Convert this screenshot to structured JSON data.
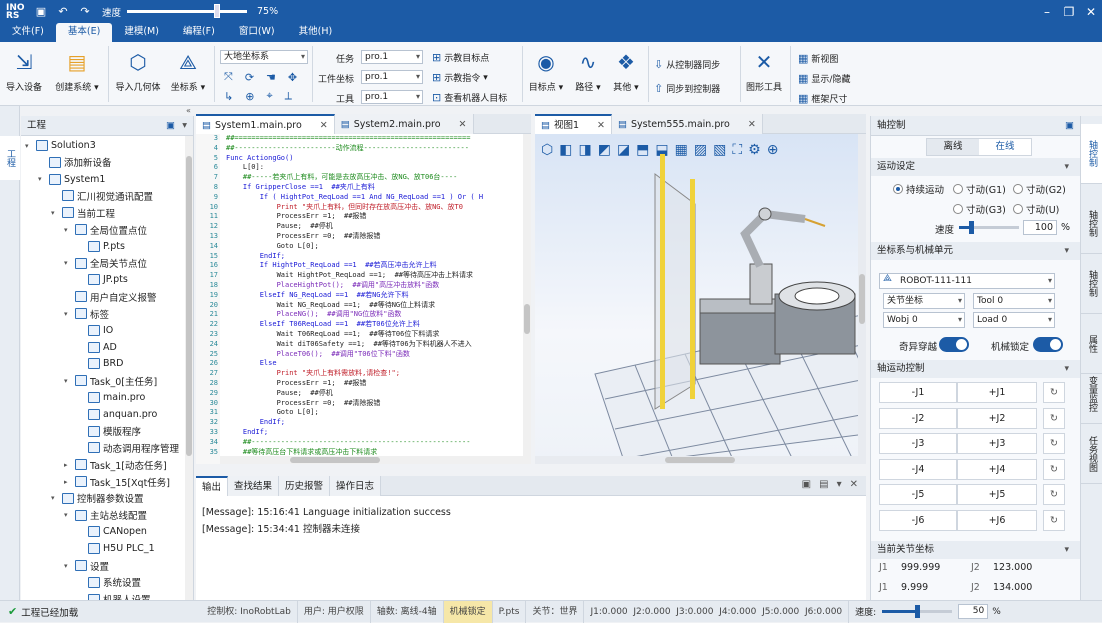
{
  "title_bar": {
    "logo": "INO RS",
    "speed_label": "速度",
    "speed_value": "75%",
    "speed_fraction": 0.75
  },
  "menu": {
    "items": [
      {
        "label": "文件(F)"
      },
      {
        "label": "基本(E)"
      },
      {
        "label": "建模(M)"
      },
      {
        "label": "编程(F)"
      },
      {
        "label": "窗口(W)"
      },
      {
        "label": "其他(H)"
      }
    ]
  },
  "ribbon": {
    "import_device": "导入设备",
    "create_system": "创建系统",
    "import_geometry": "导入几何体",
    "coord_system": "坐标系",
    "coord_select": "大地坐标系",
    "task_label": "任务",
    "task_value": "pro.1",
    "workobj_label": "工件坐标",
    "workobj_value": "pro.1",
    "tool_label": "工具",
    "tool_value": "pro.1",
    "teach_target": "示教目标点",
    "teach_cmd": "示教指令",
    "view_robot_target": "查看机器人目标",
    "target_point": "目标点",
    "path": "路径",
    "other": "其他",
    "sync_from_ctrl": "从控制器同步",
    "sync_to_ctrl": "同步到控制器",
    "graphic_tools": "图形工具",
    "new_view": "新视图",
    "show_hide": "显示/隐藏",
    "frame_size": "框架尺寸"
  },
  "project_panel": {
    "title": "工程",
    "side_tab": "工程",
    "tree": [
      {
        "label": "Solution3",
        "level": 0,
        "exp": "▾"
      },
      {
        "label": "添加新设备",
        "level": 1,
        "exp": ""
      },
      {
        "label": "System1",
        "level": 1,
        "exp": "▾"
      },
      {
        "label": "汇川视觉通讯配置",
        "level": 2,
        "exp": ""
      },
      {
        "label": "当前工程",
        "level": 2,
        "exp": "▾"
      },
      {
        "label": "全局位置点位",
        "level": 3,
        "exp": "▾"
      },
      {
        "label": "P.pts",
        "level": 4,
        "exp": ""
      },
      {
        "label": "全局关节点位",
        "level": 3,
        "exp": "▾"
      },
      {
        "label": "JP.pts",
        "level": 4,
        "exp": ""
      },
      {
        "label": "用户自定义报警",
        "level": 3,
        "exp": ""
      },
      {
        "label": "标签",
        "level": 3,
        "exp": "▾"
      },
      {
        "label": "IO",
        "level": 4,
        "exp": ""
      },
      {
        "label": "AD",
        "level": 4,
        "exp": ""
      },
      {
        "label": "BRD",
        "level": 4,
        "exp": ""
      },
      {
        "label": "Task_0[主任务]",
        "level": 3,
        "exp": "▾"
      },
      {
        "label": "main.pro",
        "level": 4,
        "exp": ""
      },
      {
        "label": "anquan.pro",
        "level": 4,
        "exp": ""
      },
      {
        "label": "模版程序",
        "level": 4,
        "exp": ""
      },
      {
        "label": "动态调用程序管理",
        "level": 4,
        "exp": ""
      },
      {
        "label": "Task_1[动态任务]",
        "level": 3,
        "exp": "▸"
      },
      {
        "label": "Task_15[Xqt任务]",
        "level": 3,
        "exp": "▸"
      },
      {
        "label": "控制器参数设置",
        "level": 2,
        "exp": "▾"
      },
      {
        "label": "主站总线配置",
        "level": 3,
        "exp": "▾"
      },
      {
        "label": "CANopen",
        "level": 4,
        "exp": ""
      },
      {
        "label": "H5U PLC_1",
        "level": 4,
        "exp": ""
      },
      {
        "label": "设置",
        "level": 3,
        "exp": "▾"
      },
      {
        "label": "系统设置",
        "level": 4,
        "exp": ""
      },
      {
        "label": "机器人设置",
        "level": 4,
        "exp": ""
      }
    ]
  },
  "editor_tabs": [
    {
      "label": "System1.main.pro"
    },
    {
      "label": "System2.main.pro"
    }
  ],
  "code_lines": [
    {
      "n": "3",
      "t": "##========================================================",
      "c": "cm"
    },
    {
      "n": "4",
      "t": "##------------------------动作流程-------------------------",
      "c": "cm"
    },
    {
      "n": "5",
      "t": "Func ActiongGo()",
      "c": "kw"
    },
    {
      "n": "6",
      "t": "    L[0]:",
      "c": ""
    },
    {
      "n": "7",
      "t": "    ##-----若夹爪上有料，可能是去放高压冲击、放NG、放T06台----",
      "c": "cm"
    },
    {
      "n": "8",
      "t": "    If GripperClose ==1  ##夹爪上有料",
      "c": "kw"
    },
    {
      "n": "9",
      "t": "        If ( HightPot_ReqLoad ==1 And NG_ReqLoad ==1 ) Or ( H",
      "c": "kw"
    },
    {
      "n": "10",
      "t": "            Print \"夹爪上有料，但同时存在放高压冲击、放NG、放T0",
      "c": "st"
    },
    {
      "n": "11",
      "t": "            ProcessErr =1;  ##报错",
      "c": ""
    },
    {
      "n": "12",
      "t": "            Pause;  ##停机",
      "c": ""
    },
    {
      "n": "13",
      "t": "            ProcessErr =0;  ##清除报错",
      "c": ""
    },
    {
      "n": "14",
      "t": "            Goto L[0];",
      "c": ""
    },
    {
      "n": "15",
      "t": "        EndIf;",
      "c": "kw"
    },
    {
      "n": "16",
      "t": "        If HightPot_ReqLoad ==1  ##若高压冲击允许上料",
      "c": "kw"
    },
    {
      "n": "17",
      "t": "            Wait HightPot_ReqLoad ==1;  ##等待高压冲击上料请求",
      "c": ""
    },
    {
      "n": "18",
      "t": "            PlaceHightPot();  ##调用\"高压冲击放料\"函数",
      "c": "fn"
    },
    {
      "n": "19",
      "t": "        ElseIf NG_ReqLoad ==1  ##若NG允许下料",
      "c": "kw"
    },
    {
      "n": "20",
      "t": "            Wait NG_ReqLoad ==1;  ##等待NG位上料请求",
      "c": ""
    },
    {
      "n": "21",
      "t": "            PlaceNG();  ##调用\"NG位放料\"函数",
      "c": "fn"
    },
    {
      "n": "22",
      "t": "        ElseIf T06ReqLoad ==1  ##若T06位允许上料",
      "c": "kw"
    },
    {
      "n": "23",
      "t": "            Wait T06ReqLoad ==1;  ##等待T06位下料请求",
      "c": ""
    },
    {
      "n": "24",
      "t": "            Wait diT06Safety ==1;  ##等待T06为下料机器人不进入",
      "c": ""
    },
    {
      "n": "25",
      "t": "            PlaceT06();  ##调用\"T06位下料\"函数",
      "c": "fn"
    },
    {
      "n": "26",
      "t": "        Else",
      "c": "kw"
    },
    {
      "n": "27",
      "t": "            Print \"夹爪上有料需放料,请检查!\";",
      "c": "st"
    },
    {
      "n": "28",
      "t": "            ProcessErr =1;  ##报错",
      "c": ""
    },
    {
      "n": "29",
      "t": "            Pause;  ##停机",
      "c": ""
    },
    {
      "n": "30",
      "t": "            ProcessErr =0;  ##清除报错",
      "c": ""
    },
    {
      "n": "31",
      "t": "            Goto L[0];",
      "c": ""
    },
    {
      "n": "32",
      "t": "        EndIf;",
      "c": "kw"
    },
    {
      "n": "33",
      "t": "    EndIf;",
      "c": "kw"
    },
    {
      "n": "34",
      "t": "    ##----------------------------------------------------",
      "c": "cm"
    },
    {
      "n": "35",
      "t": "    ##等待高压台下料请求或高压冲击下料请求",
      "c": "cm"
    }
  ],
  "view_tabs": [
    {
      "label": "视图1"
    },
    {
      "label": "System555.main.pro"
    }
  ],
  "output": {
    "tabs": [
      {
        "label": "输出"
      },
      {
        "label": "查找结果"
      },
      {
        "label": "历史报警"
      },
      {
        "label": "操作日志"
      }
    ],
    "lines": [
      "[Message]: 15:16:41 Language initialization success",
      "[Message]: 15:34:41 控制器未连接"
    ]
  },
  "axis_panel": {
    "title": "轴控制",
    "mode_tabs": [
      "离线",
      "在线"
    ],
    "motion_settings": "运动设定",
    "radios": [
      "持续运动",
      "寸动(G1)",
      "寸动(G2)",
      "寸动(G3)",
      "寸动(U)"
    ],
    "speed_label": "速度",
    "speed_value": "100",
    "speed_unit": "%",
    "speed_fraction": 0.2,
    "coord_section": "坐标系与机械单元",
    "robot": "ROBOT-111-111",
    "joint_coord": "关节坐标",
    "tool": "Tool 0",
    "wobj": "Wobj 0",
    "load": "Load 0",
    "singular": "奇异穿越",
    "mech_lock": "机械锁定",
    "jog_section": "轴运动控制",
    "jog": [
      [
        "-J1",
        "+J1"
      ],
      [
        "-J2",
        "+J2"
      ],
      [
        "-J3",
        "+J3"
      ],
      [
        "-J4",
        "+J4"
      ],
      [
        "-J5",
        "+J5"
      ],
      [
        "-J6",
        "+J6"
      ]
    ],
    "joint_section": "当前关节坐标",
    "joints": [
      {
        "k": "J1",
        "v": "999.999"
      },
      {
        "k": "J2",
        "v": "123.000"
      },
      {
        "k": "J1",
        "v": "9.999"
      },
      {
        "k": "J2",
        "v": "134.000"
      }
    ]
  },
  "side_tabs": [
    "轴控制",
    "轴控制",
    "轴控制",
    "属性",
    "变量监控",
    "任务视图"
  ],
  "status": {
    "ok": "工程已经加载",
    "controller": "控制权: InoRobtLab",
    "user": "用户: 用户权限",
    "axes": "轴数: 离线-4轴",
    "lock": "机械锁定",
    "pts": "P.pts",
    "joint": "关节：世界",
    "coords": "J1:0.000  J2:0.000  J3:0.000  J4:0.000  J5:0.000  J6:0.000",
    "speed_label": "速度:",
    "speed_value": "50",
    "speed_unit": "%",
    "speed_fraction": 0.5
  },
  "colors": {
    "brand": "#1c5ba6",
    "accent": "#2f6fb6"
  }
}
